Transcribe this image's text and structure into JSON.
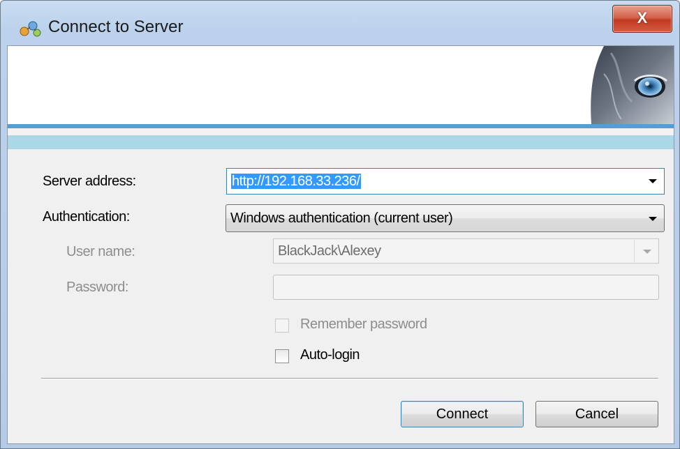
{
  "window": {
    "title": "Connect to Server",
    "close_glyph": "X"
  },
  "form": {
    "server_address_label": "Server address:",
    "server_address_value": "http://192.168.33.236/",
    "authentication_label": "Authentication:",
    "authentication_value": "Windows authentication (current user)",
    "user_name_label": "User name:",
    "user_name_value": "BlackJack\\Alexey",
    "password_label": "Password:",
    "password_value": "",
    "remember_password_label": "Remember password",
    "remember_password_checked": false,
    "auto_login_label": "Auto-login",
    "auto_login_checked": false
  },
  "buttons": {
    "connect": "Connect",
    "cancel": "Cancel"
  },
  "colors": {
    "selection": "#3399ff",
    "banner_stripe": "#4f9fd8",
    "banner_band": "#aad8e6",
    "close": "#c23a22"
  }
}
